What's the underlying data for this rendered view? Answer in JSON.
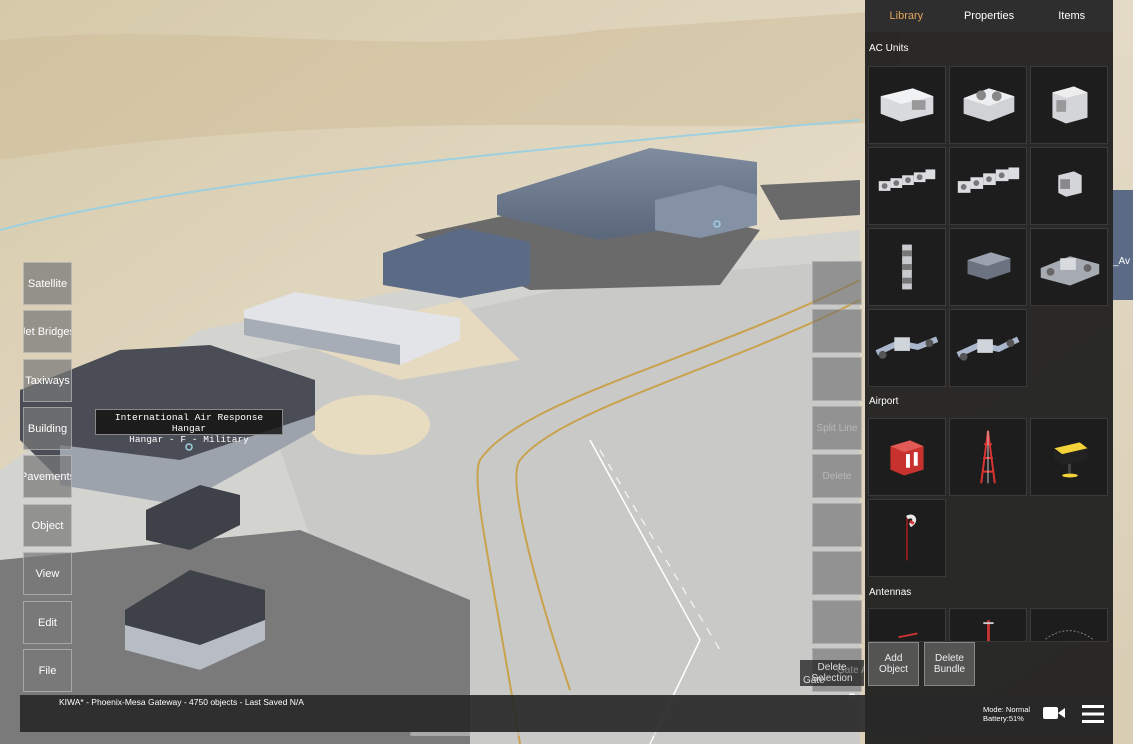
{
  "left_buttons": [
    "Satellite",
    "Jet Bridges",
    "Taxiways",
    "Building",
    "Pavements",
    "Object",
    "View",
    "Edit",
    "File"
  ],
  "right_buttons": [
    "",
    "",
    "",
    "Split Line",
    "Delete",
    "",
    "",
    "",
    ""
  ],
  "scene_label": {
    "line1": "International Air Response Hangar",
    "line2": "Hangar - F - Military"
  },
  "floating_labels": {
    "delete_selection": "Delete Selection",
    "gate": "Gate",
    "gate_airline": "Gate Airline",
    "edge_text": "_Av"
  },
  "panel": {
    "tabs": [
      "Library",
      "Properties",
      "Items"
    ],
    "active_tab": "Library",
    "sections": [
      {
        "title": "AC Units",
        "items": [
          "ac-unit-1",
          "ac-unit-2",
          "ac-unit-3",
          "ac-unit-4",
          "ac-unit-5",
          "ac-unit-6",
          "ac-unit-7",
          "ac-unit-8",
          "ac-unit-9",
          "ac-unit-10",
          "ac-unit-11"
        ]
      },
      {
        "title": "Airport",
        "items": [
          "airport-box",
          "airport-tower",
          "airport-sign",
          "airport-windsock"
        ]
      },
      {
        "title": "Antennas",
        "items": [
          "antenna-1",
          "antenna-2",
          "antenna-3"
        ]
      }
    ],
    "buttons": {
      "add_object": "Add Object",
      "delete_bundle": "Delete Bundle"
    }
  },
  "status": {
    "text": "KIWA* - Phoenix-Mesa Gateway - 4750 objects - Last Saved N/A",
    "mode": "Mode: Normal",
    "battery": "Battery:51%"
  },
  "icons": {
    "camera": "camera-icon",
    "menu": "hamburger-menu-icon"
  },
  "colors": {
    "accent": "#e4a45c",
    "panel_bg": "#1e1e1e"
  }
}
